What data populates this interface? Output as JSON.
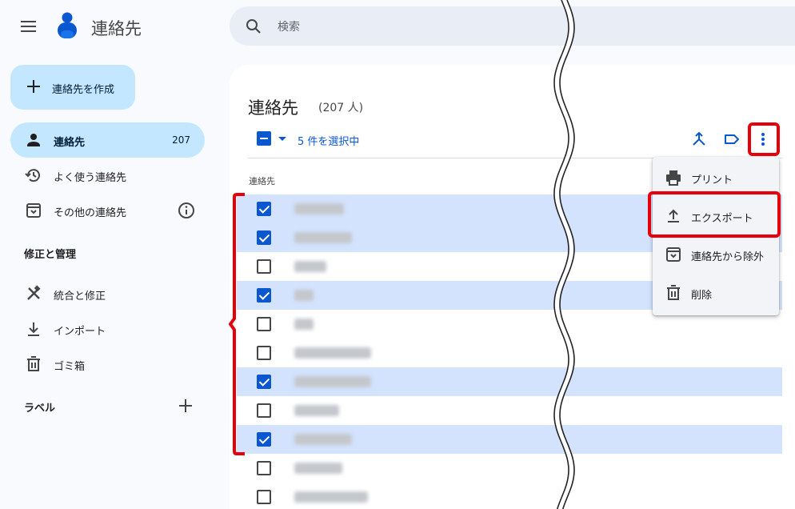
{
  "app": {
    "title": "連絡先"
  },
  "search": {
    "placeholder": "検索"
  },
  "sidebar": {
    "create_label": "連絡先を作成",
    "items": [
      {
        "label": "連絡先",
        "count": "207",
        "icon": "person-icon",
        "active": true
      },
      {
        "label": "よく使う連絡先",
        "icon": "history-icon"
      },
      {
        "label": "その他の連絡先",
        "icon": "archive-download-icon",
        "info": "info-icon"
      }
    ],
    "manage_heading": "修正と管理",
    "manage_items": [
      {
        "label": "統合と修正",
        "icon": "tools-icon"
      },
      {
        "label": "インポート",
        "icon": "download-icon"
      },
      {
        "label": "ゴミ箱",
        "icon": "trash-icon"
      }
    ],
    "labels_heading": "ラベル"
  },
  "main": {
    "title": "連絡先",
    "count": "(207 人)",
    "selection_text": "5 件を選択中",
    "column_header": "連絡先",
    "rows": [
      {
        "selected": true
      },
      {
        "selected": true
      },
      {
        "selected": false
      },
      {
        "selected": true
      },
      {
        "selected": false
      },
      {
        "selected": false
      },
      {
        "selected": true
      },
      {
        "selected": false
      },
      {
        "selected": true
      },
      {
        "selected": false
      },
      {
        "selected": false
      }
    ]
  },
  "menu": {
    "items": [
      {
        "label": "プリント",
        "icon": "print-icon"
      },
      {
        "label": "エクスポート",
        "icon": "upload-icon"
      },
      {
        "label": "連絡先から除外",
        "icon": "archive-icon"
      },
      {
        "label": "削除",
        "icon": "trash-icon"
      }
    ]
  },
  "colors": {
    "accent": "#0b57d0",
    "active_nav": "#c2e7ff",
    "selected_row": "#d3e3fd",
    "highlight": "#e6000a",
    "page_bg": "#f8fafd"
  }
}
